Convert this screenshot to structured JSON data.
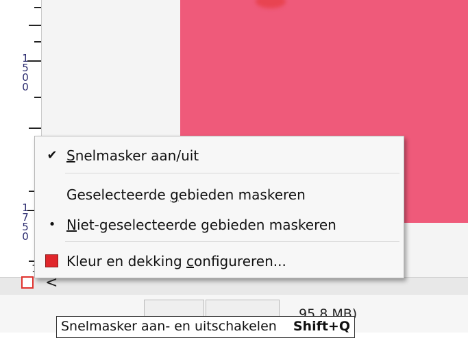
{
  "colors": {
    "canvas_fill": "#ef5a7a",
    "canvas_blob": "#e84451",
    "quickmask_accent": "#e0322d"
  },
  "ruler": {
    "label_1500": "1500",
    "label_1750": "1750"
  },
  "quickmask_button": {
    "icon": "quickmask-toggle-icon",
    "side_label": "1"
  },
  "scroll": {
    "left_arrow": "<"
  },
  "context_menu": {
    "items": [
      {
        "check": "✔",
        "label_pre": "",
        "label_u": "S",
        "label_post": "nelmasker aan/uit"
      },
      {
        "check": "",
        "label_pre": "Geselecteerde ",
        "label_u": "g",
        "label_post": "ebieden maskeren"
      },
      {
        "check": "•",
        "label_pre": "",
        "label_u": "N",
        "label_post": "iet-geselecteerde gebieden maskeren"
      },
      {
        "check": "",
        "label_pre": "Kleur en dekking ",
        "label_u": "c",
        "label_post": "onfigureren..."
      }
    ]
  },
  "statusbar": {
    "size_text": "95,8 MB)"
  },
  "tooltip": {
    "text": "Snelmasker aan- en uitschakelen",
    "shortcut": "Shift+Q"
  }
}
